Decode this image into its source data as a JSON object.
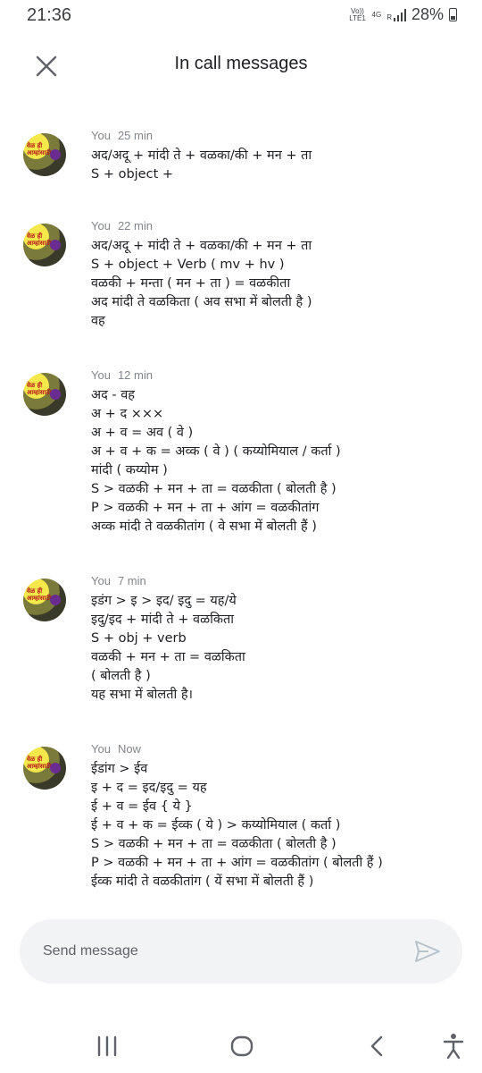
{
  "status": {
    "time": "21:36",
    "volte": "Vo)) LTE1",
    "network": "4G",
    "roaming": "R",
    "battery": "28%"
  },
  "header": {
    "title": "In call messages"
  },
  "messages": [
    {
      "sender": "You",
      "time": "25 min",
      "lines": [
        "अद/अदू + मांदी ते + वळका/की + मन + ता",
        "S  + object +"
      ]
    },
    {
      "sender": "You",
      "time": "22 min",
      "lines": [
        "अद/अदू + मांदी ते + वळका/की + मन + ता",
        "S  + object + Verb ( mv + hv )",
        "वळकी + मन्ता ( मन + ता ) = वळकीता",
        "अद मांदी ते वळकिता ( अव सभा में बोलती है )",
        "वह"
      ]
    },
    {
      "sender": "You",
      "time": "12 min",
      "lines": [
        "अद - वह",
        "अ + द  ×××",
        "अ + व = अव ( वे )",
        "अ + व + क = अव्क  ( वे ) ( कय्योमियाल / कर्ता )",
        "मांदी ( कय्योम )",
        "S > वळकी + मन + ता = वळकीता ( बोलती है )",
        "P > वळकी + मन + ता + आंग = वळकीतांग",
        "अव्क मांदी ते वळकीतांग ( वे सभा में बोलती हैं )"
      ]
    },
    {
      "sender": "You",
      "time": "7 min",
      "lines": [
        "इडंग > इ > इद/ इदु = यह/ये",
        "इदु/इद + मांदी ते + वळकिता",
        "S  +  obj + verb",
        "वळकी + मन + ता = वळकिता",
        "( बोलती है )",
        "यह सभा में बोलती है।"
      ]
    },
    {
      "sender": "You",
      "time": "Now",
      "lines": [
        "ईडांग > ईव",
        "इ + द = इद/इदु = यह",
        "ई + व = ईव { ये }",
        "ई + व + क = ईव्क ( ये ) > कय्योमियाल ( कर्ता )",
        "S > वळकी + मन + ता = वळकीता ( बोलती है )",
        "P > वळकी + मन + ता + आंग = वळकीतांग ( बोलती हैं )",
        "ईव्क मांदी ते वळकीतांग ( यें सभा में बोलती हैं )"
      ]
    }
  ],
  "avatar_text": "वेळ ही आम्हांसाठी",
  "composer": {
    "placeholder": "Send message"
  }
}
